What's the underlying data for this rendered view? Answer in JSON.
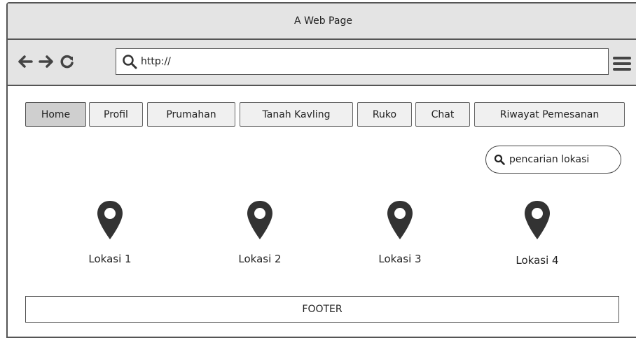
{
  "window": {
    "title": "A Web Page"
  },
  "toolbar": {
    "back_icon": "arrow-left-icon",
    "forward_icon": "arrow-right-icon",
    "reload_icon": "reload-icon",
    "url": "http://",
    "menu_icon": "hamburger-menu-icon"
  },
  "nav": {
    "tabs": [
      {
        "label": "Home",
        "active": true
      },
      {
        "label": "Profil",
        "active": false
      },
      {
        "label": "Prumahan",
        "active": false
      },
      {
        "label": "Tanah Kavling",
        "active": false
      },
      {
        "label": "Ruko",
        "active": false
      },
      {
        "label": "Chat",
        "active": false
      },
      {
        "label": "Riwayat Pemesanan",
        "active": false
      }
    ]
  },
  "search": {
    "label": "pencarian lokasi",
    "icon": "search-icon"
  },
  "locations": [
    {
      "label": "Lokasi 1",
      "icon": "map-pin-icon"
    },
    {
      "label": "Lokasi 2",
      "icon": "map-pin-icon"
    },
    {
      "label": "Lokasi 3",
      "icon": "map-pin-icon"
    },
    {
      "label": "Lokasi 4",
      "icon": "map-pin-icon"
    }
  ],
  "footer": {
    "label": "FOOTER"
  },
  "colors": {
    "chrome": "#e4e4e4",
    "border": "#555555",
    "active_tab": "#cfcfcf",
    "pin": "#333333"
  }
}
